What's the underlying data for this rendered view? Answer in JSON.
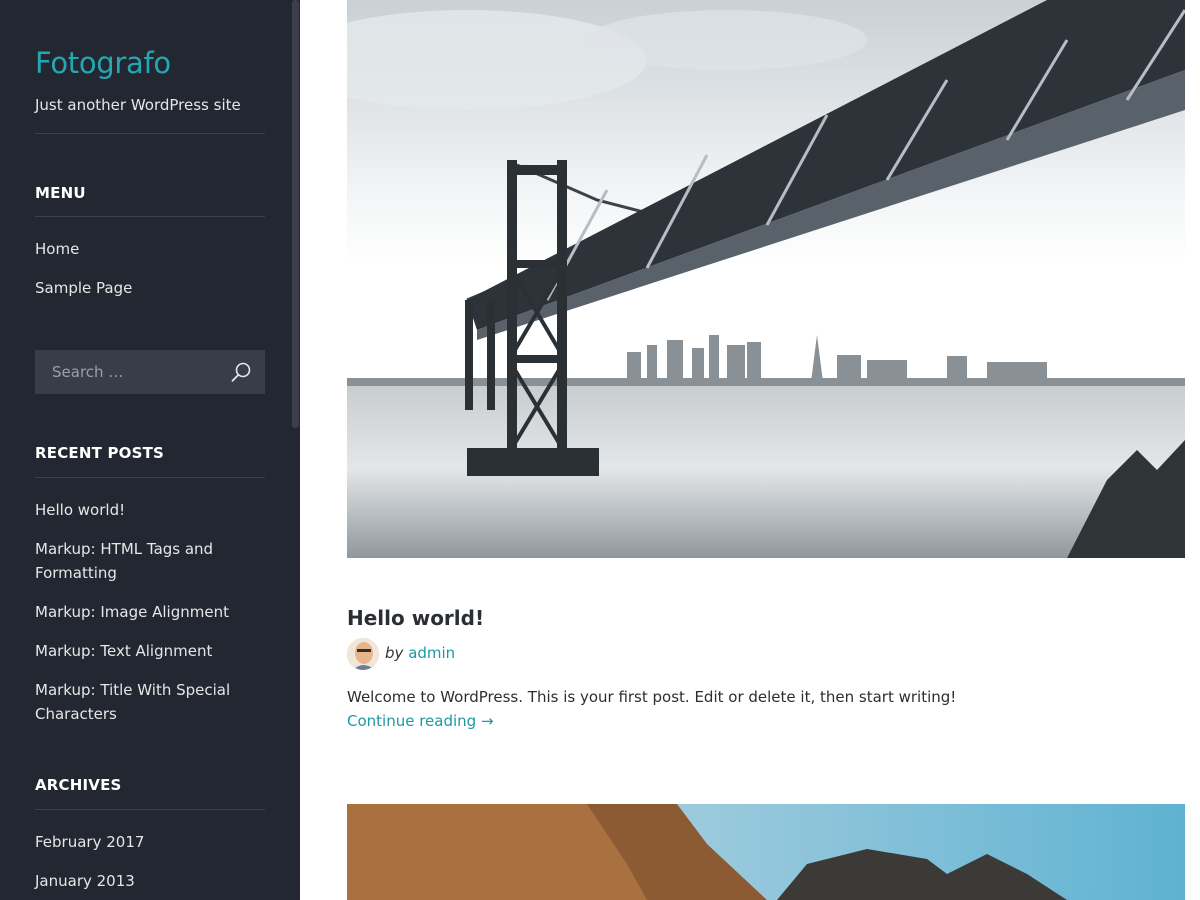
{
  "site": {
    "title": "Fotografo",
    "description": "Just another WordPress site"
  },
  "menu": {
    "title": "MENU",
    "items": [
      "Home",
      "Sample Page"
    ]
  },
  "search": {
    "placeholder": "Search …",
    "icon": "search-icon"
  },
  "recent_posts": {
    "title": "RECENT POSTS",
    "items": [
      "Hello world!",
      "Markup: HTML Tags and Formatting",
      "Markup: Image Alignment",
      "Markup: Text Alignment",
      "Markup: Title With Special Characters"
    ]
  },
  "archives": {
    "title": "ARCHIVES",
    "items": [
      "February 2017",
      "January 2013"
    ]
  },
  "post": {
    "title": "Hello world!",
    "by": "by",
    "author": "admin",
    "excerpt": "Welcome to WordPress. This is your first post. Edit or delete it, then start writing!",
    "continue": "Continue reading →"
  },
  "colors": {
    "sidebar": "#222731",
    "accent": "#26a6b1",
    "link": "#1a9aa5"
  }
}
